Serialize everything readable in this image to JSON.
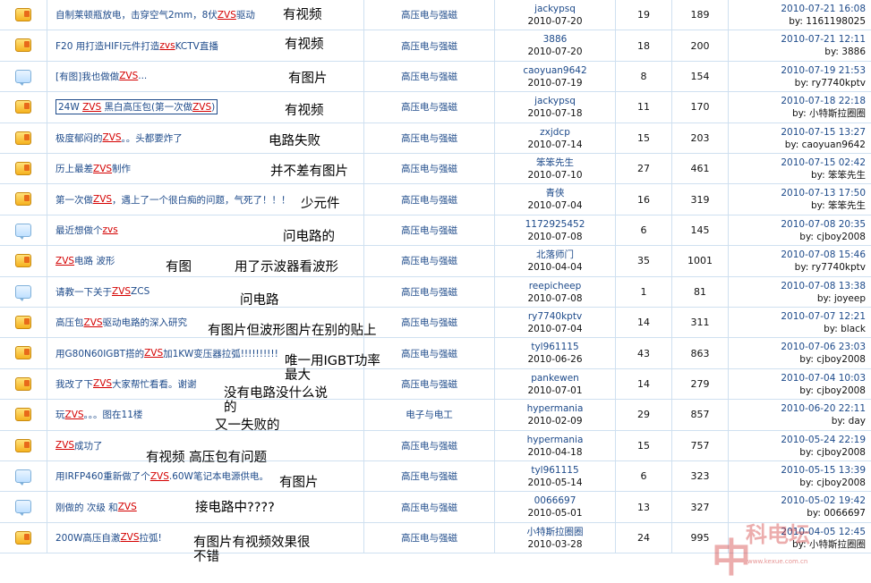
{
  "rows": [
    {
      "icon": "hot-topic-icon",
      "title": [
        {
          "t": "自制莱顿瓶放电，击穿空气2mm，8伏"
        },
        {
          "t": "ZVS",
          "hl": true
        },
        {
          "t": "驱动"
        }
      ],
      "note": "有视频",
      "forum": "高压电与强磁",
      "author": "jackypsq",
      "date": "2010-07-20",
      "replies": "19",
      "views": "189",
      "last_time": "2010-07-21 16:08",
      "last_by": "by: 1161198025"
    },
    {
      "icon": "hot-topic-icon",
      "title": [
        {
          "t": "F20 用打造HIFI元件打造"
        },
        {
          "t": "zvs",
          "hl": true
        },
        {
          "t": "  KCTV直播"
        }
      ],
      "note": "有视频",
      "forum": "高压电与强磁",
      "author": "3886",
      "date": "2010-07-20",
      "replies": "18",
      "views": "200",
      "last_time": "2010-07-21 12:11",
      "last_by": "by: 3886"
    },
    {
      "icon": "topic-icon",
      "title": [
        {
          "t": "[有图]我也做做"
        },
        {
          "t": "ZVS",
          "hl": true
        },
        {
          "t": "..."
        }
      ],
      "note": "有图片",
      "forum": "高压电与强磁",
      "author": "caoyuan9642",
      "date": "2010-07-19",
      "replies": "8",
      "views": "154",
      "last_time": "2010-07-19 21:53",
      "last_by": "by: ry7740kptv"
    },
    {
      "icon": "hot-topic-icon",
      "boxed": true,
      "title": [
        {
          "t": "24W "
        },
        {
          "t": "ZVS",
          "hl": true
        },
        {
          "t": "  黑白高压包(第一次做"
        },
        {
          "t": "ZVS",
          "hl": true
        },
        {
          "t": ")"
        }
      ],
      "note": "有视频",
      "forum": "高压电与强磁",
      "author": "jackypsq",
      "date": "2010-07-18",
      "replies": "11",
      "views": "170",
      "last_time": "2010-07-18 22:18",
      "last_by": "by: 小特斯拉圈圈"
    },
    {
      "icon": "hot-topic-icon",
      "title": [
        {
          "t": "极度郁闷的"
        },
        {
          "t": "ZVS",
          "hl": true
        },
        {
          "t": "。。头都要炸了"
        }
      ],
      "note": "电路失败",
      "forum": "高压电与强磁",
      "author": "zxjdcp",
      "date": "2010-07-14",
      "replies": "15",
      "views": "203",
      "last_time": "2010-07-15 13:27",
      "last_by": "by: caoyuan9642"
    },
    {
      "icon": "hot-topic-icon",
      "title": [
        {
          "t": "历上最差"
        },
        {
          "t": "ZVS",
          "hl": true
        },
        {
          "t": "制作"
        }
      ],
      "note": "并不差有图片",
      "forum": "高压电与强磁",
      "author": "笨笨先生",
      "date": "2010-07-10",
      "replies": "27",
      "views": "461",
      "last_time": "2010-07-15 02:42",
      "last_by": "by: 笨笨先生"
    },
    {
      "icon": "hot-topic-icon",
      "title": [
        {
          "t": "第一次做"
        },
        {
          "t": "ZVS",
          "hl": true
        },
        {
          "t": "，遇上了一个很白痴的问题，气死了！！！"
        }
      ],
      "note": "少元件",
      "forum": "高压电与强磁",
      "author": "青侠",
      "date": "2010-07-04",
      "replies": "16",
      "views": "319",
      "last_time": "2010-07-13 17:50",
      "last_by": "by: 笨笨先生"
    },
    {
      "icon": "topic-icon",
      "title": [
        {
          "t": "最近想做个"
        },
        {
          "t": "zvs",
          "hl": true
        }
      ],
      "note": "问电路的",
      "forum": "高压电与强磁",
      "author": "1172925452",
      "date": "2010-07-08",
      "replies": "6",
      "views": "145",
      "last_time": "2010-07-08 20:35",
      "last_by": "by: cjboy2008"
    },
    {
      "icon": "hot-topic-icon",
      "title": [
        {
          "t": "ZVS",
          "hl": true
        },
        {
          "t": "电路  波形"
        }
      ],
      "note": "有图",
      "note2": "用了示波器看波形",
      "forum": "高压电与强磁",
      "author": "北落师门",
      "date": "2010-04-04",
      "replies": "35",
      "views": "1001",
      "last_time": "2010-07-08 15:46",
      "last_by": "by: ry7740kptv"
    },
    {
      "icon": "topic-icon",
      "title": [
        {
          "t": "请教一下关于"
        },
        {
          "t": "ZVS",
          "hl": true
        },
        {
          "t": "  ZCS"
        }
      ],
      "note": "问电路",
      "forum": "高压电与强磁",
      "author": "reepicheep",
      "date": "2010-07-08",
      "replies": "1",
      "views": "81",
      "last_time": "2010-07-08 13:38",
      "last_by": "by: joyeep"
    },
    {
      "icon": "hot-topic-icon",
      "title": [
        {
          "t": "高压包"
        },
        {
          "t": "ZVS",
          "hl": true
        },
        {
          "t": "驱动电路的深入研究"
        }
      ],
      "note": "有图片但波形图片在别的贴上",
      "forum": "高压电与强磁",
      "author": "ry7740kptv",
      "date": "2010-07-04",
      "replies": "14",
      "views": "311",
      "last_time": "2010-07-07 12:21",
      "last_by": "by: black"
    },
    {
      "icon": "hot-topic-icon",
      "title": [
        {
          "t": "用G80N60IGBT搭的"
        },
        {
          "t": "ZVS",
          "hl": true
        },
        {
          "t": "加1KW变压器拉弧!!!!!!!!!!"
        }
      ],
      "note": "唯一用IGBT功率",
      "note_b": "最大",
      "forum": "高压电与强磁",
      "author": "tyl961115",
      "date": "2010-06-26",
      "replies": "43",
      "views": "863",
      "last_time": "2010-07-06 23:03",
      "last_by": "by: cjboy2008"
    },
    {
      "icon": "hot-topic-icon",
      "title": [
        {
          "t": "我改了下"
        },
        {
          "t": "ZVS",
          "hl": true
        },
        {
          "t": "大家帮忙看看。谢谢"
        }
      ],
      "note": "没有电路没什么说",
      "note_b": "的",
      "forum": "高压电与强磁",
      "author": "pankewen",
      "date": "2010-07-01",
      "replies": "14",
      "views": "279",
      "last_time": "2010-07-04 10:03",
      "last_by": "by: cjboy2008"
    },
    {
      "icon": "hot-topic-icon",
      "title": [
        {
          "t": "玩"
        },
        {
          "t": "ZVS",
          "hl": true
        },
        {
          "t": "。。。图在11楼"
        }
      ],
      "note": "又一失败的",
      "forum": "电子与电工",
      "author": "hypermania",
      "date": "2010-02-09",
      "replies": "29",
      "views": "857",
      "last_time": "2010-06-20 22:11",
      "last_by": "by: day"
    },
    {
      "icon": "hot-topic-icon",
      "title": [
        {
          "t": "ZVS",
          "hl": true
        },
        {
          "t": "成功了"
        }
      ],
      "note": "有视频 高压包有问题",
      "forum": "高压电与强磁",
      "author": "hypermania",
      "date": "2010-04-18",
      "replies": "15",
      "views": "757",
      "last_time": "2010-05-24 22:19",
      "last_by": "by: cjboy2008"
    },
    {
      "icon": "topic-icon",
      "title": [
        {
          "t": "用IRFP460重新做了个"
        },
        {
          "t": "ZVS",
          "hl": true
        },
        {
          "t": ".60W笔记本电源供电。"
        }
      ],
      "note": "有图片",
      "forum": "高压电与强磁",
      "author": "tyl961115",
      "date": "2010-05-14",
      "replies": "6",
      "views": "323",
      "last_time": "2010-05-15 13:39",
      "last_by": "by: cjboy2008"
    },
    {
      "icon": "topic-icon",
      "title": [
        {
          "t": "刚做的 次级 和"
        },
        {
          "t": "ZVS",
          "hl": true
        }
      ],
      "note": "接电路中????",
      "forum": "高压电与强磁",
      "author": "0066697",
      "date": "2010-05-01",
      "replies": "13",
      "views": "327",
      "last_time": "2010-05-02 19:42",
      "last_by": "by: 0066697"
    },
    {
      "icon": "hot-topic-icon",
      "title": [
        {
          "t": "200W高压自激"
        },
        {
          "t": "ZVS",
          "hl": true
        },
        {
          "t": "拉弧!"
        }
      ],
      "note": "有图片有视频效果很",
      "note_b": "不错",
      "forum": "高压电与强磁",
      "author": "小特斯拉圈圈",
      "date": "2010-03-28",
      "replies": "24",
      "views": "995",
      "last_time": "2010-04-05 12:45",
      "last_by": "by: 小特斯拉圈圈"
    }
  ],
  "watermark": {
    "chars": [
      "中",
      "科",
      "电",
      "坛"
    ],
    "sub": "www.kexue.com.cn"
  }
}
